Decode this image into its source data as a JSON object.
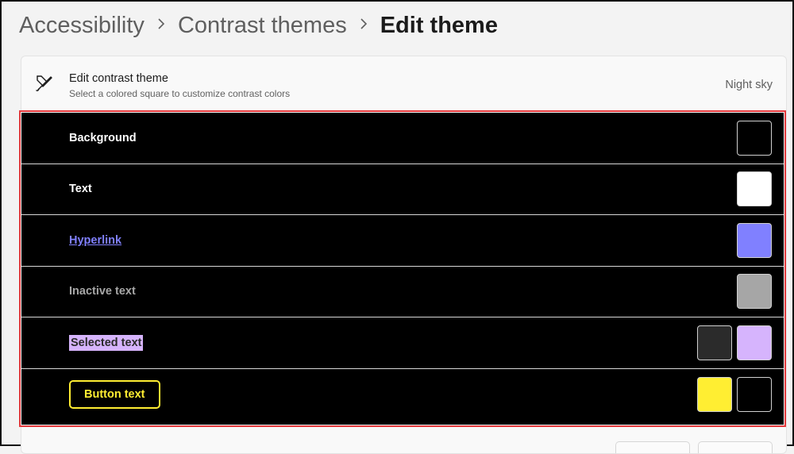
{
  "breadcrumb": {
    "items": [
      "Accessibility",
      "Contrast themes"
    ],
    "current": "Edit theme"
  },
  "header": {
    "title": "Edit contrast theme",
    "subtitle": "Select a colored square to customize contrast colors",
    "theme_name": "Night sky"
  },
  "rows": [
    {
      "label": "Background",
      "swatches": [
        "#000000"
      ]
    },
    {
      "label": "Text",
      "swatches": [
        "#ffffff"
      ]
    },
    {
      "label": "Hyperlink",
      "swatches": [
        "#8080ff"
      ]
    },
    {
      "label": "Inactive text",
      "swatches": [
        "#a6a6a6"
      ]
    },
    {
      "label": "Selected text",
      "swatches": [
        "#2b2b2b",
        "#d6b4fd"
      ]
    },
    {
      "label": "Button text",
      "swatches": [
        "#ffee32",
        "#000000"
      ]
    }
  ],
  "colors": {
    "highlight_border": "#e5393c",
    "panel_background": "#000000"
  },
  "icons": {
    "header": "paintbrush-icon",
    "breadcrumb_separator": "chevron-right-icon"
  }
}
